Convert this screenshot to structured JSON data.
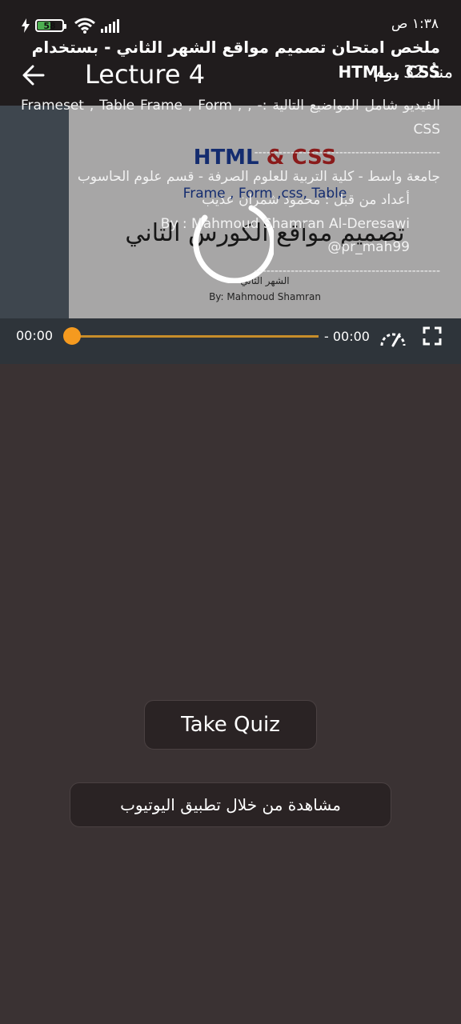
{
  "status_bar": {
    "time": "١:٣٨ ص",
    "battery_level": "58",
    "battery_fraction": 0.58,
    "icons": [
      "charging-icon",
      "battery-icon",
      "wifi-icon",
      "cellular-signal-icon"
    ]
  },
  "app_bar": {
    "title": "Lecture 4",
    "date": "منذُ 32 يوم",
    "back_icon": "arrow-left-icon"
  },
  "video": {
    "slide_title_html": "HTML",
    "slide_title_amp": "&",
    "slide_title_css": "CSS",
    "slide_subtitle": "Frame , Form ,css, Table",
    "slide_arabic": "تصميم مواقع الكورس الثاني",
    "slide_arabic_small": "الشهر الثاني",
    "slide_author": "By: Mahmoud Shamran",
    "current_time": "00:00",
    "end_time": "- 00:00",
    "progress": 0,
    "accent_color": "#f59a1f"
  },
  "description": {
    "title": "ملخص امتحان تصميم مواقع الشهر الثاني - بستخدام HTML , CSS",
    "line1": "الفيديو شامل المواضيع التالية :- , Frameset , Table Frame , Form , CSS",
    "separator1": "----------------------------------------------",
    "line2": "جامعة واسط - كلية التربية للعلوم الصرفة - قسم علوم الحاسوب",
    "line3": "أعداد من قبل : محمود شمران عذيب",
    "line4": "By : Mahmoud Shamran Al-Deresawi",
    "line5": "@pr_mah99",
    "separator2": "----------------------------------------------"
  },
  "buttons": {
    "take_quiz": "Take Quiz",
    "watch_youtube": "مشاهدة من خلال تطبيق اليوتيوب"
  },
  "colors": {
    "background": "#3a3233",
    "app_bar": "#201c1d",
    "button": "#2a2324",
    "battery": "#4caf50"
  }
}
